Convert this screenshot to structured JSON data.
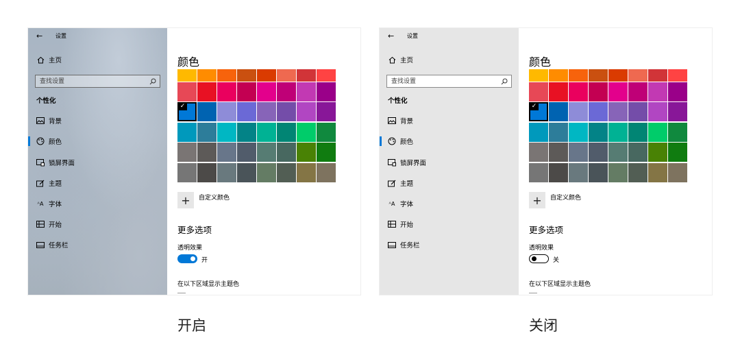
{
  "colors": {
    "accent": "#0078d7",
    "swatch_rows": [
      [
        "#ffb900",
        "#ff8c00",
        "#f7630c",
        "#ca5010",
        "#da3b01",
        "#ef6950",
        "#d13438",
        "#ff4343"
      ],
      [
        "#e74856",
        "#e81123",
        "#ea005e",
        "#c30052",
        "#e3008c",
        "#bf0077",
        "#c239b3",
        "#9a0089"
      ],
      [
        "#0078d7",
        "#0063b1",
        "#8e8cd8",
        "#6b69d6",
        "#8764b8",
        "#744da9",
        "#b146c2",
        "#881798"
      ],
      [
        "#0099bc",
        "#2d7d9a",
        "#00b7c3",
        "#038387",
        "#00b294",
        "#018574",
        "#00cc6a",
        "#10893e"
      ],
      [
        "#7a7574",
        "#5d5a58",
        "#68768a",
        "#515c6b",
        "#567c73",
        "#486860",
        "#498205",
        "#107c10"
      ],
      [
        "#767676",
        "#4c4a48",
        "#69797e",
        "#4a5459",
        "#647c64",
        "#525e54",
        "#847545",
        "#7e735f"
      ]
    ],
    "selected_swatch": {
      "row": 2,
      "col": 0
    }
  },
  "panels": [
    {
      "back_label": "设置",
      "nav": {
        "home": "主页",
        "search_placeholder": "查找设置",
        "section": "个性化",
        "items": [
          "背景",
          "颜色",
          "锁屏界面",
          "主题",
          "字体",
          "开始",
          "任务栏"
        ],
        "selected_index": 1
      },
      "content": {
        "title": "颜色",
        "custom_color_label": "自定义颜色",
        "more_options_title": "更多选项",
        "transparency_label": "透明效果",
        "transparency_on": true,
        "transparency_state_label": "开",
        "accent_surfaces_label": "在以下区域显示主题色"
      },
      "caption": "开启"
    },
    {
      "back_label": "设置",
      "nav": {
        "home": "主页",
        "search_placeholder": "查找设置",
        "section": "个性化",
        "items": [
          "背景",
          "颜色",
          "锁屏界面",
          "主题",
          "字体",
          "开始",
          "任务栏"
        ],
        "selected_index": 1
      },
      "content": {
        "title": "颜色",
        "custom_color_label": "自定义颜色",
        "more_options_title": "更多选项",
        "transparency_label": "透明效果",
        "transparency_on": false,
        "transparency_state_label": "关",
        "accent_surfaces_label": "在以下区域显示主题色"
      },
      "caption": "关闭"
    }
  ],
  "icons": {
    "back": "back-arrow-icon",
    "home": "home-icon",
    "search": "search-icon",
    "nav_items": [
      "picture-icon",
      "palette-icon",
      "lock-screen-icon",
      "theme-brush-icon",
      "font-icon",
      "start-menu-icon",
      "taskbar-icon"
    ]
  }
}
